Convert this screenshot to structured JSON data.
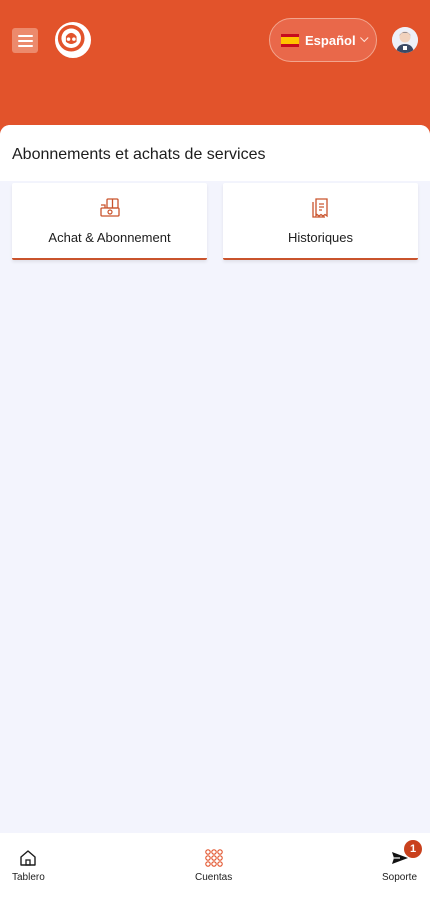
{
  "header": {
    "language": {
      "flag": "spain-flag",
      "label": "Español"
    },
    "menu_icon": "hamburger-icon",
    "logo_icon": "brand-logo",
    "avatar_icon": "user-avatar-icon"
  },
  "page": {
    "title": "Abonnements et achats de services",
    "cards": [
      {
        "label": "Achat & Abonnement",
        "icon": "purchase-subscription-icon"
      },
      {
        "label": "Historiques",
        "icon": "receipt-history-icon"
      }
    ]
  },
  "bottom_nav": {
    "items": [
      {
        "label": "Tablero",
        "icon": "home-icon"
      },
      {
        "label": "Cuentas",
        "icon": "grid-icon"
      },
      {
        "label": "Soporte",
        "icon": "send-icon"
      }
    ],
    "support_badge": "1"
  },
  "colors": {
    "brand": "#e2532b",
    "accent": "#c9532c",
    "background": "#f3f4fd"
  }
}
